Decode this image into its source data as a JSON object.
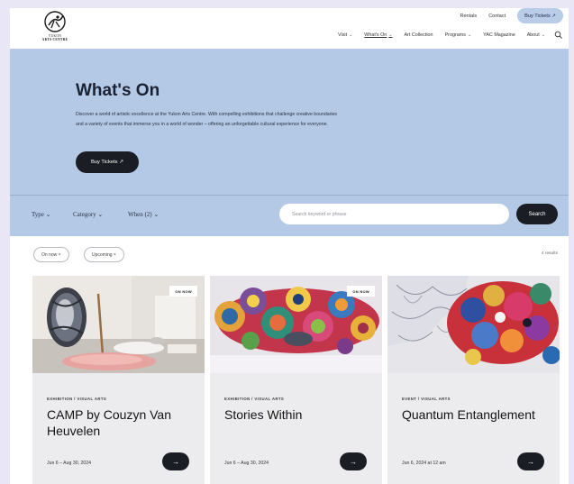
{
  "brand": {
    "line1": "YUKON",
    "line2": "ARTS CENTRE"
  },
  "util_links": [
    "Rentals",
    "Contact"
  ],
  "buy_tickets_top": "Buy Tickets ↗",
  "nav": [
    {
      "label": "Visit",
      "has_dropdown": true
    },
    {
      "label": "What's On",
      "has_dropdown": true,
      "active": true
    },
    {
      "label": "Art Collection",
      "has_dropdown": false
    },
    {
      "label": "Programs",
      "has_dropdown": true
    },
    {
      "label": "YAC Magazine",
      "has_dropdown": false
    },
    {
      "label": "About",
      "has_dropdown": true
    }
  ],
  "hero": {
    "title": "What's On",
    "description": "Discover a world of artistic excellence at the Yukon Arts Centre. With compelling exhibitions that challenge creative boundaries and a variety of events that immerse you in a world of wonder – offering an unforgettable cultural experience for everyone.",
    "button": "Buy Tickets ↗"
  },
  "filters": {
    "type": "Type",
    "category": "Category",
    "when": "When (2)"
  },
  "search": {
    "placeholder": "Search keyword or phrase",
    "button": "Search"
  },
  "chips": [
    "On now ×",
    "Upcoming ×"
  ],
  "results": "4 results",
  "cards": [
    {
      "badge": "ON NOW",
      "category": "EXHIBITION / VISUAL ARTS",
      "title": "CAMP by Couzyn Van Heuvelen",
      "date": "Jun 6 – Aug 30, 2024",
      "arrow": "→"
    },
    {
      "badge": "ON NOW",
      "category": "EXHIBITION / VISUAL ARTS",
      "title": "Stories Within",
      "date": "Jun 6 – Aug 30, 2024",
      "arrow": "→"
    },
    {
      "badge": "",
      "category": "EVENT / VISUAL ARTS",
      "title": "Quantum Entanglement",
      "date": "Jun 6, 2024 at 12 am",
      "arrow": "→"
    }
  ],
  "colors": {
    "hero_bg": "#b4c9e5",
    "button_dark": "#1b1d24",
    "buy_top_bg": "#b9cde9",
    "card_bg": "#ececee",
    "page_bg": "#e9e6f6"
  },
  "icons": {
    "logo": "dancer-logo-icon",
    "search": "search-icon",
    "arrow": "arrow-right-icon",
    "chevron": "chevron-down-icon",
    "external": "external-link-icon"
  }
}
